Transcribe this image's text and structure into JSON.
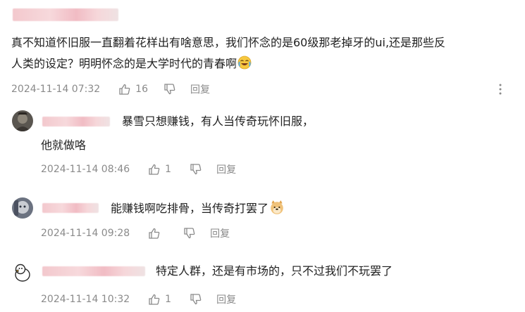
{
  "main_comment": {
    "text_line1": "真不知道怀旧服一直翻着花样出有啥意思，我们怀念的是60级那老掉牙的ui,还是那些反",
    "text_line2": "人类的设定？明明怀念的是大学时代的青春啊",
    "emoji_icon": "laughing-crying-emoji-icon",
    "timestamp": "2024-11-14 07:32",
    "likes": "16",
    "reply_label": "回复"
  },
  "replies": [
    {
      "text_line1": "暴雪只想赚钱，有人当传奇玩怀旧服，",
      "text_line2": "他就做咯",
      "timestamp": "2024-11-14 08:46",
      "likes": "1",
      "reply_label": "回复"
    },
    {
      "text_line1": "能赚钱啊吃排骨，当传奇打罢了",
      "emoji_icon": "doge-emoji-icon",
      "timestamp": "2024-11-14 09:28",
      "likes": "",
      "reply_label": "回复"
    },
    {
      "text_line1": "特定人群，还是有市场的，只不过我们不玩罢了",
      "timestamp": "2024-11-14 10:32",
      "likes": "1",
      "reply_label": "回复"
    }
  ]
}
